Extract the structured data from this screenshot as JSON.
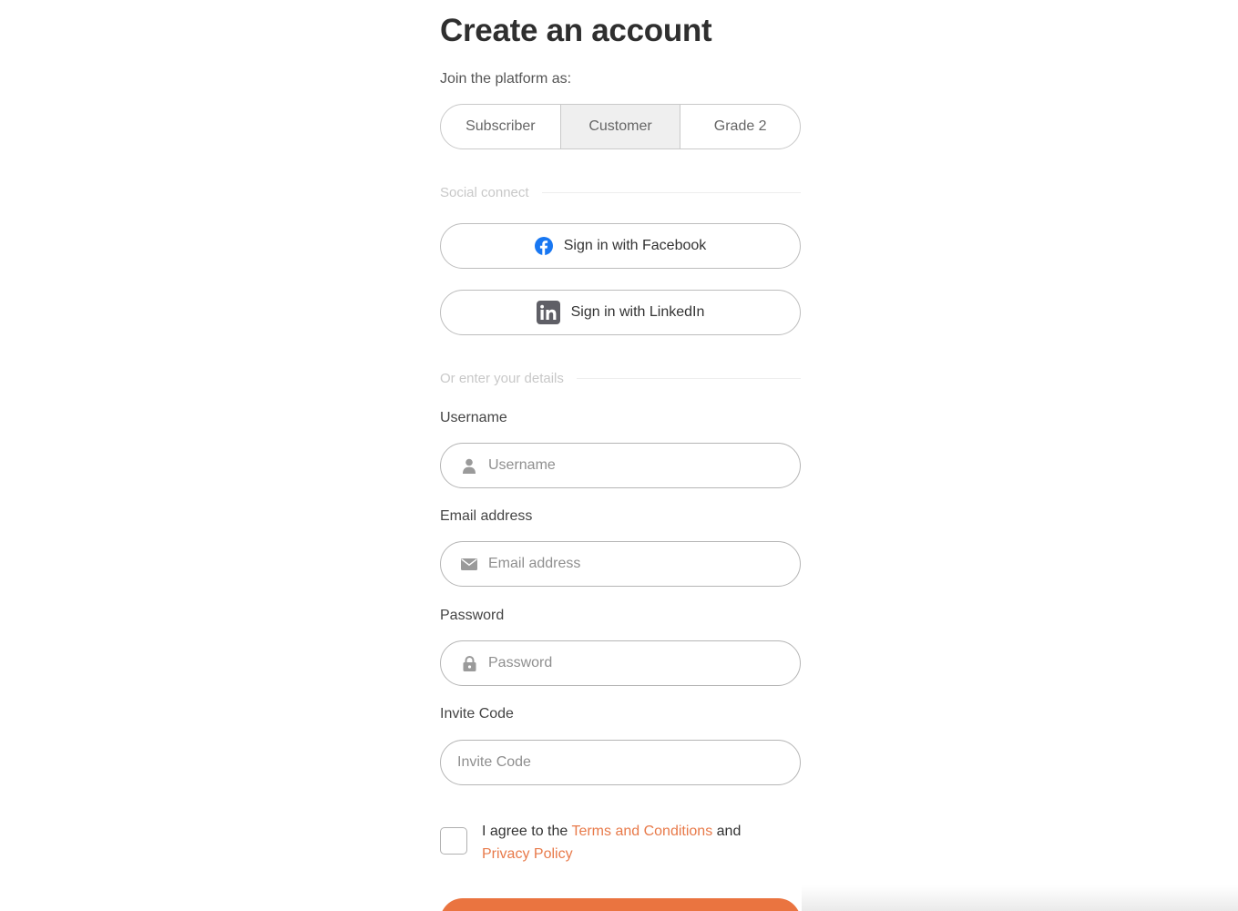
{
  "title": "Create an account",
  "join_label": "Join the platform as:",
  "roles": [
    {
      "label": "Subscriber",
      "active": false
    },
    {
      "label": "Customer",
      "active": true
    },
    {
      "label": "Grade 2",
      "active": false
    }
  ],
  "social": {
    "divider_label": "Social connect",
    "facebook_label": "Sign in with Facebook",
    "linkedin_label": "Sign in with LinkedIn",
    "facebook_color": "#1877f2"
  },
  "details": {
    "divider_label": "Or enter your details",
    "username": {
      "label": "Username",
      "placeholder": "Username",
      "icon": "user-icon"
    },
    "email": {
      "label": "Email address",
      "placeholder": "Email address",
      "icon": "mail-icon"
    },
    "password": {
      "label": "Password",
      "placeholder": "Password",
      "icon": "lock-icon"
    },
    "invite": {
      "label": "Invite Code",
      "placeholder": "Invite Code"
    }
  },
  "agree": {
    "prefix": "I agree to the",
    "terms_link": "Terms and Conditions",
    "joiner": "and",
    "privacy_link": "Privacy Policy",
    "link_color": "#e87a4a"
  },
  "submit": {
    "color": "#ea7440"
  }
}
